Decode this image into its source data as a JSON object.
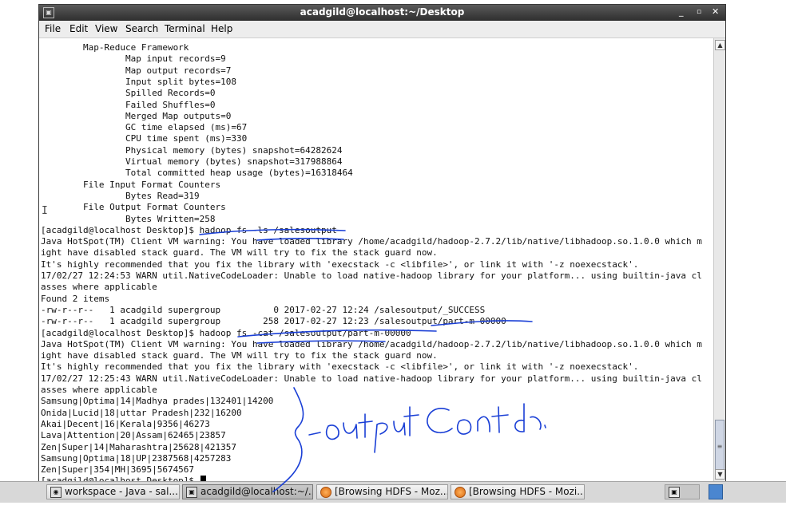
{
  "window": {
    "title": "acadgild@localhost:~/Desktop",
    "app_icon": "terminal-icon",
    "controls": [
      "_",
      "▫",
      "✕"
    ]
  },
  "menu": [
    "File",
    "Edit",
    "View",
    "Search",
    "Terminal",
    "Help"
  ],
  "terminal_lines": [
    "        Map-Reduce Framework",
    "                Map input records=9",
    "                Map output records=7",
    "                Input split bytes=108",
    "                Spilled Records=0",
    "                Failed Shuffles=0",
    "                Merged Map outputs=0",
    "                GC time elapsed (ms)=67",
    "                CPU time spent (ms)=330",
    "                Physical memory (bytes) snapshot=64282624",
    "                Virtual memory (bytes) snapshot=317988864",
    "                Total committed heap usage (bytes)=16318464",
    "        File Input Format Counters",
    "                Bytes Read=319",
    "        File Output Format Counters",
    "                Bytes Written=258",
    "[acadgild@localhost Desktop]$ hadoop fs -ls /salesoutput",
    "Java HotSpot(TM) Client VM warning: You have loaded library /home/acadgild/hadoop-2.7.2/lib/native/libhadoop.so.1.0.0 which m",
    "ight have disabled stack guard. The VM will try to fix the stack guard now.",
    "It's highly recommended that you fix the library with 'execstack -c <libfile>', or link it with '-z noexecstack'.",
    "17/02/27 12:24:53 WARN util.NativeCodeLoader: Unable to load native-hadoop library for your platform... using builtin-java cl",
    "asses where applicable",
    "Found 2 items",
    "-rw-r--r--   1 acadgild supergroup          0 2017-02-27 12:24 /salesoutput/_SUCCESS",
    "-rw-r--r--   1 acadgild supergroup        258 2017-02-27 12:23 /salesoutput/part-m-00000",
    "[acadgild@localhost Desktop]$ hadoop fs -cat /salesoutput/part-m-00000",
    "Java HotSpot(TM) Client VM warning: You have loaded library /home/acadgild/hadoop-2.7.2/lib/native/libhadoop.so.1.0.0 which m",
    "ight have disabled stack guard. The VM will try to fix the stack guard now.",
    "It's highly recommended that you fix the library with 'execstack -c <libfile>', or link it with '-z noexecstack'.",
    "17/02/27 12:25:43 WARN util.NativeCodeLoader: Unable to load native-hadoop library for your platform... using builtin-java cl",
    "asses where applicable",
    "Samsung|Optima|14|Madhya prades|132401|14200",
    "Onida|Lucid|18|uttar Pradesh|232|16200",
    "Akai|Decent|16|Kerala|9356|46273",
    "Lava|Attention|20|Assam|62465|23857",
    "Zen|Super|14|Maharashtra|25628|421357",
    "Samsung|Optima|18|UP|2387568|4257283",
    "Zen|Super|354|MH|3695|5674567"
  ],
  "prompt": "[acadgild@localhost Desktop]$ ",
  "annotation_text": "-output contd.",
  "taskbar": [
    {
      "label": "workspace - Java - sal...",
      "icon": "eclipse-icon",
      "active": false
    },
    {
      "label": "acadgild@localhost:~/...",
      "icon": "terminal-icon",
      "active": true
    },
    {
      "label": "[Browsing HDFS - Moz...",
      "icon": "firefox-icon",
      "active": false
    },
    {
      "label": "[Browsing HDFS - Mozi...",
      "icon": "firefox-icon",
      "active": false
    }
  ],
  "colors": {
    "ink": "#1a3fd6",
    "titlebar": "#3a3a3a"
  }
}
